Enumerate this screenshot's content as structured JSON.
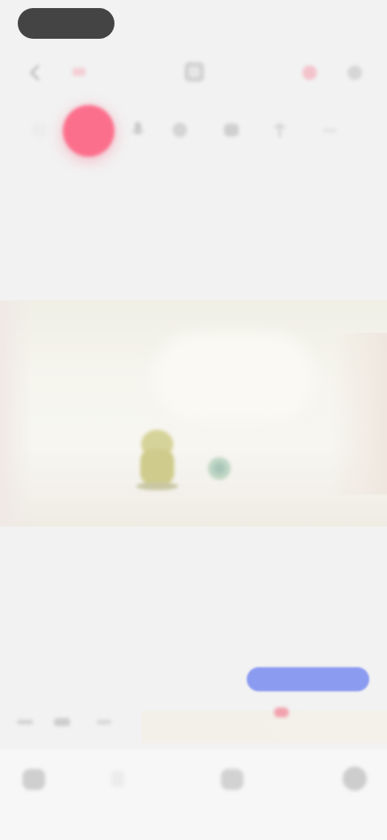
{
  "status_bar": {
    "time": ""
  },
  "colors": {
    "record": "#fb6f8c",
    "accent_blue": "#7a8df0",
    "background": "#f2f2f2",
    "icon_gray": "#9a9a9a"
  },
  "top_bar": {
    "icons": [
      "back-icon",
      "library-icon",
      "heart-icon",
      "more-icon"
    ]
  },
  "tool_row": {
    "icons": [
      "record-button",
      "mic-icon",
      "text-icon",
      "sticker-icon",
      "effect-icon",
      "undo-icon"
    ]
  },
  "bottom_nav": {
    "items": [
      {
        "name": "home",
        "label": ""
      },
      {
        "name": "edit",
        "label": ""
      },
      {
        "name": "share",
        "label": ""
      },
      {
        "name": "profile",
        "label": ""
      }
    ]
  }
}
